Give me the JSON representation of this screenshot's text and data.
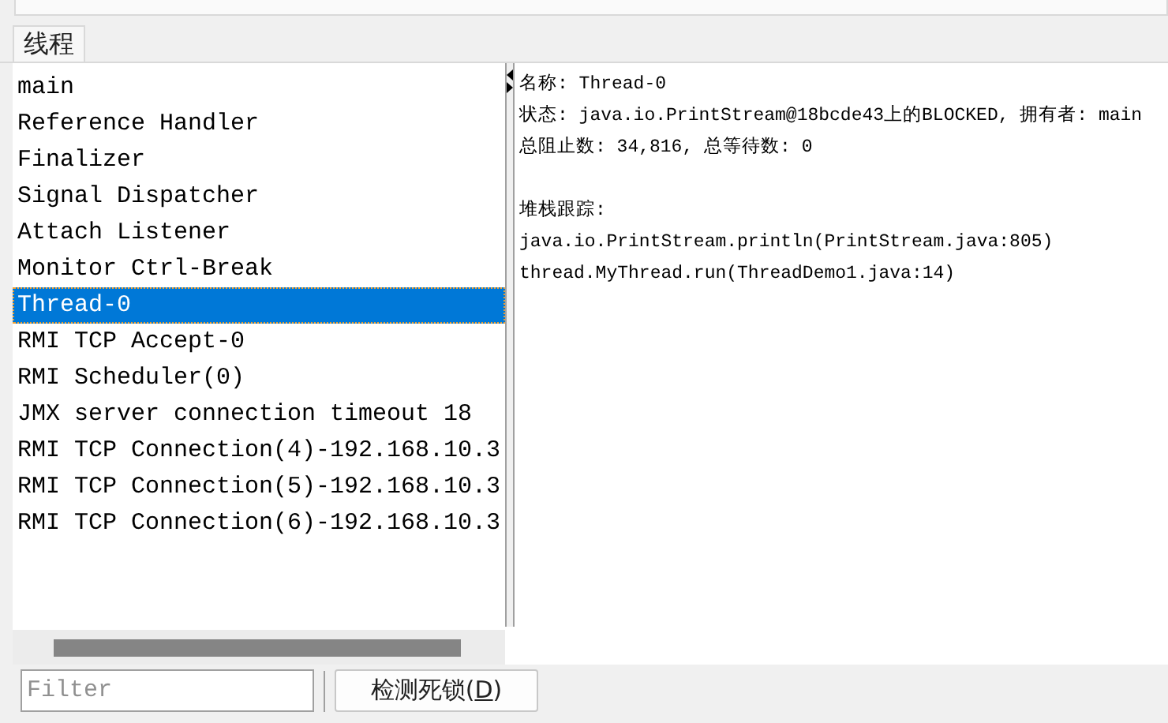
{
  "tabs": [
    {
      "label": "线程",
      "selected": true
    }
  ],
  "threads": [
    {
      "name": "main",
      "selected": false
    },
    {
      "name": "Reference Handler",
      "selected": false
    },
    {
      "name": "Finalizer",
      "selected": false
    },
    {
      "name": "Signal Dispatcher",
      "selected": false
    },
    {
      "name": "Attach Listener",
      "selected": false
    },
    {
      "name": "Monitor Ctrl-Break",
      "selected": false
    },
    {
      "name": "Thread-0",
      "selected": true
    },
    {
      "name": "RMI TCP Accept-0",
      "selected": false
    },
    {
      "name": "RMI Scheduler(0)",
      "selected": false
    },
    {
      "name": "JMX server connection timeout 18",
      "selected": false
    },
    {
      "name": "RMI TCP Connection(4)-192.168.10.3",
      "selected": false
    },
    {
      "name": "RMI TCP Connection(5)-192.168.10.3",
      "selected": false
    },
    {
      "name": "RMI TCP Connection(6)-192.168.10.3",
      "selected": false
    }
  ],
  "details": {
    "info": [
      "名称: Thread-0",
      "状态: java.io.PrintStream@18bcde43上的BLOCKED, 拥有者: main",
      "总阻止数: 34,816, 总等待数: 0"
    ],
    "stack_title": "堆栈跟踪:",
    "stack": [
      "java.io.PrintStream.println(PrintStream.java:805)",
      "thread.MyThread.run(ThreadDemo1.java:14)"
    ]
  },
  "filter": {
    "placeholder": "Filter"
  },
  "button": {
    "label_before": "检测死锁(",
    "mnemonic": "D",
    "label_after": ")"
  }
}
